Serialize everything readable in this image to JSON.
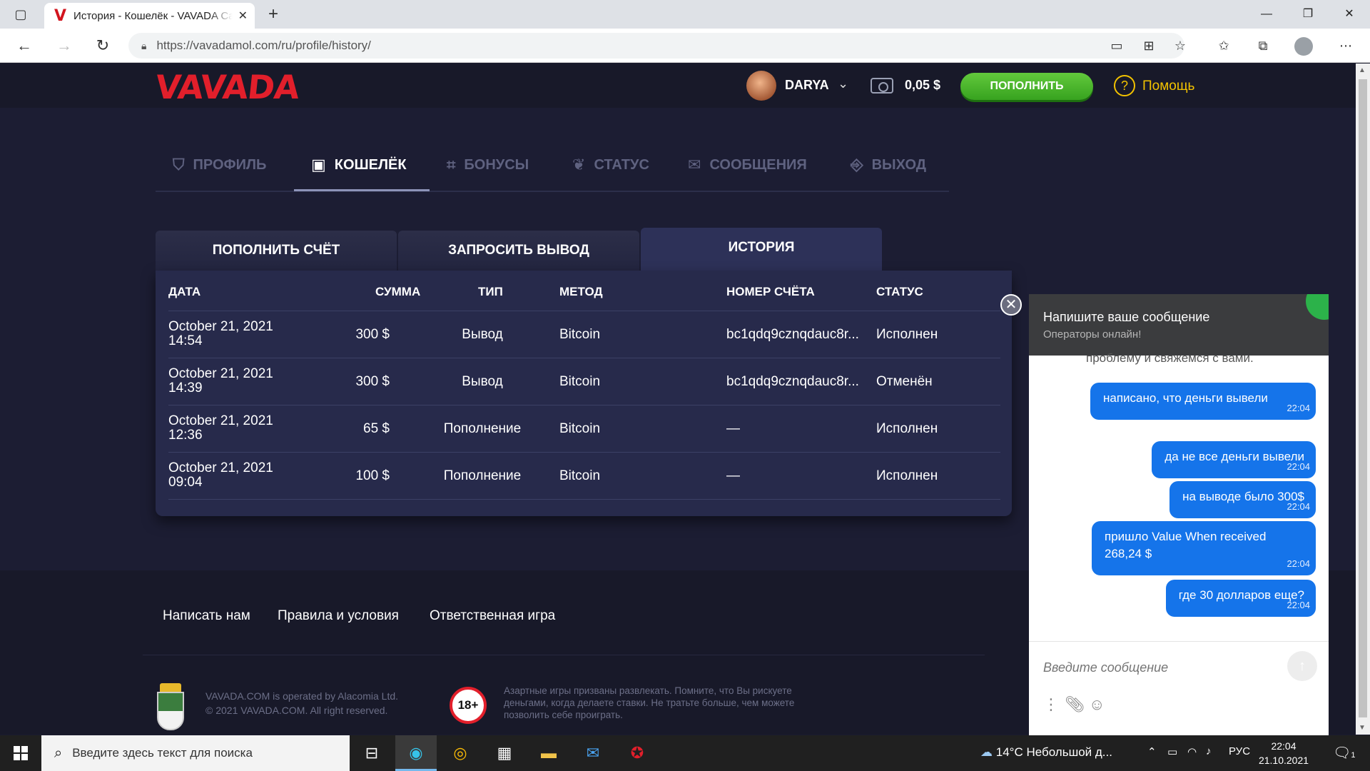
{
  "browser": {
    "tab_title": "История - Кошелёк - VAVADA Casino",
    "tab_favicon": "V",
    "url": "https://vavadamol.com/ru/profile/history/"
  },
  "header": {
    "logo": "VAVADA",
    "username": "DARYA",
    "balance": "0,05 $",
    "deposit_button": "ПОПОЛНИТЬ",
    "help_label": "Помощь"
  },
  "profile_nav": [
    {
      "label": "ПРОФИЛЬ",
      "icon": "shield-icon",
      "active": false
    },
    {
      "label": "КОШЕЛЁК",
      "icon": "wallet-icon",
      "active": true
    },
    {
      "label": "БОНУСЫ",
      "icon": "gift-icon",
      "active": false
    },
    {
      "label": "СТАТУС",
      "icon": "laurel-icon",
      "active": false
    },
    {
      "label": "СООБЩЕНИЯ",
      "icon": "envelope-icon",
      "active": false
    },
    {
      "label": "ВЫХОД",
      "icon": "door-icon",
      "active": false
    }
  ],
  "wallet_tabs": [
    {
      "label": "ПОПОЛНИТЬ СЧЁТ",
      "active": false
    },
    {
      "label": "ЗАПРОСИТЬ ВЫВОД",
      "active": false
    },
    {
      "label": "ИСТОРИЯ",
      "active": true
    }
  ],
  "history": {
    "columns": [
      "ДАТА",
      "СУММА",
      "ТИП",
      "МЕТОД",
      "НОМЕР СЧЁТА",
      "СТАТУС"
    ],
    "rows": [
      {
        "date": "October 21, 2021",
        "time": "14:54",
        "amount": "300 $",
        "type": "Вывод",
        "method": "Bitcoin",
        "account": "bc1qdq9cznqdauc8r...",
        "status": "Исполнен"
      },
      {
        "date": "October 21, 2021",
        "time": "14:39",
        "amount": "300 $",
        "type": "Вывод",
        "method": "Bitcoin",
        "account": "bc1qdq9cznqdauc8r...",
        "status": "Отменён"
      },
      {
        "date": "October 21, 2021",
        "time": "12:36",
        "amount": "65 $",
        "type": "Пополнение",
        "method": "Bitcoin",
        "account": "—",
        "status": "Исполнен"
      },
      {
        "date": "October 21, 2021",
        "time": "09:04",
        "amount": "100 $",
        "type": "Пополнение",
        "method": "Bitcoin",
        "account": "—",
        "status": "Исполнен"
      }
    ]
  },
  "footer": {
    "links": [
      "Написать нам",
      "Правила и условия",
      "Ответственная игра"
    ],
    "operator_line1": "VAVADA.COM is operated by Alacomia Ltd.",
    "operator_line2": "© 2021 VAVADA.COM. All right reserved.",
    "age": "18+",
    "warning": "Азартные игры призваны развлекать. Помните, что Вы рискуете деньгами, когда делаете ставки. Не тратьте больше, чем можете позволить себе проиграть."
  },
  "chat": {
    "title": "Напишите ваше сообщение",
    "subtitle": "Операторы онлайн!",
    "partial_message": "проблему и свяжемся с вами.",
    "messages": [
      {
        "text": "написано, что деньги вывели",
        "time": "22:04"
      },
      {
        "text": "да не все деньги вывели",
        "time": "22:04"
      },
      {
        "text": "на выводе было 300$",
        "time": "22:04"
      },
      {
        "text": "пришло Value When received 268,24 $",
        "time": "22:04"
      },
      {
        "text": "где 30 долларов еще?",
        "time": "22:04"
      }
    ],
    "input_placeholder": "Введите сообщение",
    "status_color": "#2cb24a"
  },
  "taskbar": {
    "search_placeholder": "Введите здесь текст для поиска",
    "weather": "14°C  Небольшой д...",
    "language": "РУС",
    "time": "22:04",
    "date": "21.10.2021",
    "notification_count": "1"
  }
}
